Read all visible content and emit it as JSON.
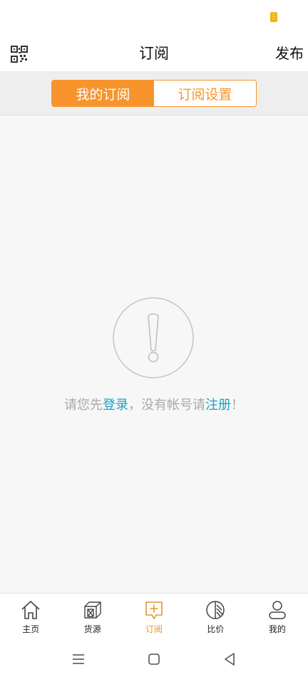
{
  "header": {
    "title": "订阅",
    "publish_label": "发布",
    "qr_icon": "qr-code-icon"
  },
  "segment": {
    "tabs": [
      {
        "label": "我的订阅",
        "active": true
      },
      {
        "label": "订阅设置",
        "active": false
      }
    ],
    "accent_color": "#f7942c"
  },
  "empty_state": {
    "icon": "exclamation-circle-icon",
    "text_before": "请您先",
    "login_link": "登录",
    "text_middle": "，没有帐号请",
    "register_link": "注册",
    "text_after": "！",
    "link_color": "#1aa0c8"
  },
  "tab_bar": {
    "items": [
      {
        "label": "主页",
        "icon": "home-icon",
        "active": false
      },
      {
        "label": "货源",
        "icon": "box-icon",
        "active": false
      },
      {
        "label": "订阅",
        "icon": "subscribe-icon",
        "active": true
      },
      {
        "label": "比价",
        "icon": "compare-icon",
        "active": false
      },
      {
        "label": "我的",
        "icon": "user-icon",
        "active": false
      }
    ],
    "active_color": "#e8932e"
  },
  "system_nav": {
    "icons": [
      "menu-icon",
      "home-square-icon",
      "back-triangle-icon"
    ]
  },
  "status_bar": {
    "battery_color": "#f5b301"
  }
}
